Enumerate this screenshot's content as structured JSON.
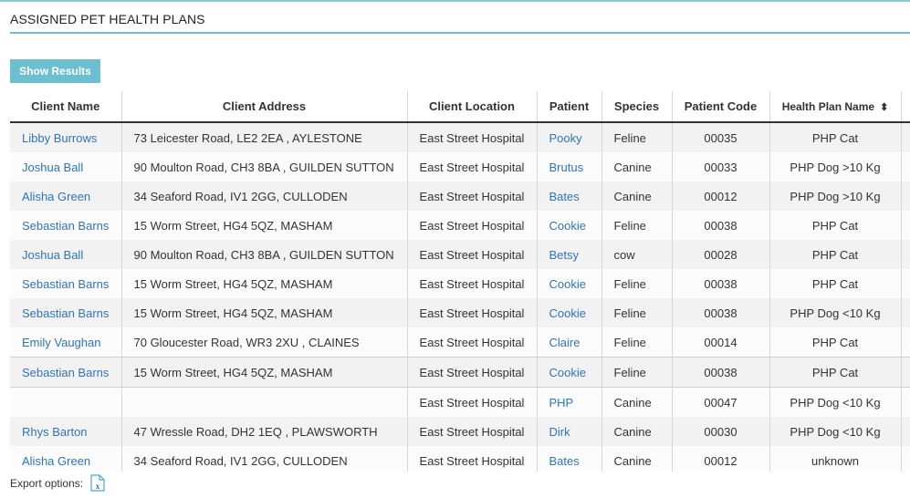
{
  "page": {
    "title": "ASSIGNED PET HEALTH PLANS",
    "show_results_label": "Show Results",
    "export_label": "Export options:",
    "export_icon": "excel-export-icon",
    "accent_color": "#6bbfd1",
    "link_color": "#2f74b5"
  },
  "table": {
    "columns": [
      {
        "label": "Client Name"
      },
      {
        "label": "Client Address"
      },
      {
        "label": "Client Location"
      },
      {
        "label": "Patient"
      },
      {
        "label": "Species"
      },
      {
        "label": "Patient Code"
      },
      {
        "label": "Health Plan Name",
        "sort_icon": "sort-both-icon",
        "sort_glyph": "⬍"
      }
    ],
    "rows": [
      {
        "client_name": "Libby Burrows",
        "client_address": "73 Leicester Road, LE2 2EA , AYLESTONE",
        "client_location": "East Street Hospital",
        "patient": "Pooky",
        "species": "Feline",
        "patient_code": "00035",
        "health_plan": "PHP Cat"
      },
      {
        "client_name": "Joshua Ball",
        "client_address": "90 Moulton Road, CH3 8BA , GUILDEN SUTTON",
        "client_location": "East Street Hospital",
        "patient": "Brutus",
        "species": "Canine",
        "patient_code": "00033",
        "health_plan": "PHP Dog >10 Kg"
      },
      {
        "client_name": "Alisha Green",
        "client_address": "34 Seaford Road, IV1 2GG, CULLODEN",
        "client_location": "East Street Hospital",
        "patient": "Bates",
        "species": "Canine",
        "patient_code": "00012",
        "health_plan": "PHP Dog >10 Kg"
      },
      {
        "client_name": "Sebastian Barns",
        "client_address": "15 Worm Street, HG4 5QZ, MASHAM",
        "client_location": "East Street Hospital",
        "patient": "Cookie",
        "species": "Feline",
        "patient_code": "00038",
        "health_plan": "PHP Cat"
      },
      {
        "client_name": "Joshua Ball",
        "client_address": "90 Moulton Road, CH3 8BA , GUILDEN SUTTON",
        "client_location": "East Street Hospital",
        "patient": "Betsy",
        "species": "cow",
        "patient_code": "00028",
        "health_plan": "PHP Cat"
      },
      {
        "client_name": "Sebastian Barns",
        "client_address": "15 Worm Street, HG4 5QZ, MASHAM",
        "client_location": "East Street Hospital",
        "patient": "Cookie",
        "species": "Feline",
        "patient_code": "00038",
        "health_plan": "PHP Cat"
      },
      {
        "client_name": "Sebastian Barns",
        "client_address": "15 Worm Street, HG4 5QZ, MASHAM",
        "client_location": "East Street Hospital",
        "patient": "Cookie",
        "species": "Feline",
        "patient_code": "00038",
        "health_plan": "PHP Dog <10 Kg"
      },
      {
        "client_name": "Emily Vaughan",
        "client_address": "70 Gloucester Road, WR3 2XU , CLAINES",
        "client_location": "East Street Hospital",
        "patient": "Claire",
        "species": "Feline",
        "patient_code": "00014",
        "health_plan": "PHP Cat"
      },
      {
        "client_name": "Sebastian Barns",
        "client_address": "15 Worm Street, HG4 5QZ, MASHAM",
        "client_location": "East Street Hospital",
        "patient": "Cookie",
        "species": "Feline",
        "patient_code": "00038",
        "health_plan": "PHP Cat"
      },
      {
        "client_name": "",
        "client_address": "",
        "client_location": "East Street Hospital",
        "patient": "PHP",
        "species": "Canine",
        "patient_code": "00047",
        "health_plan": "PHP Dog <10 Kg"
      },
      {
        "client_name": "Rhys Barton",
        "client_address": "47 Wressle Road, DH2 1EQ , PLAWSWORTH",
        "client_location": "East Street Hospital",
        "patient": "Dirk",
        "species": "Canine",
        "patient_code": "00030",
        "health_plan": "PHP Dog <10 Kg"
      },
      {
        "client_name": "Alisha Green",
        "client_address": "34 Seaford Road, IV1 2GG, CULLODEN",
        "client_location": "East Street Hospital",
        "patient": "Bates",
        "species": "Canine",
        "patient_code": "00012",
        "health_plan": "unknown"
      }
    ]
  }
}
